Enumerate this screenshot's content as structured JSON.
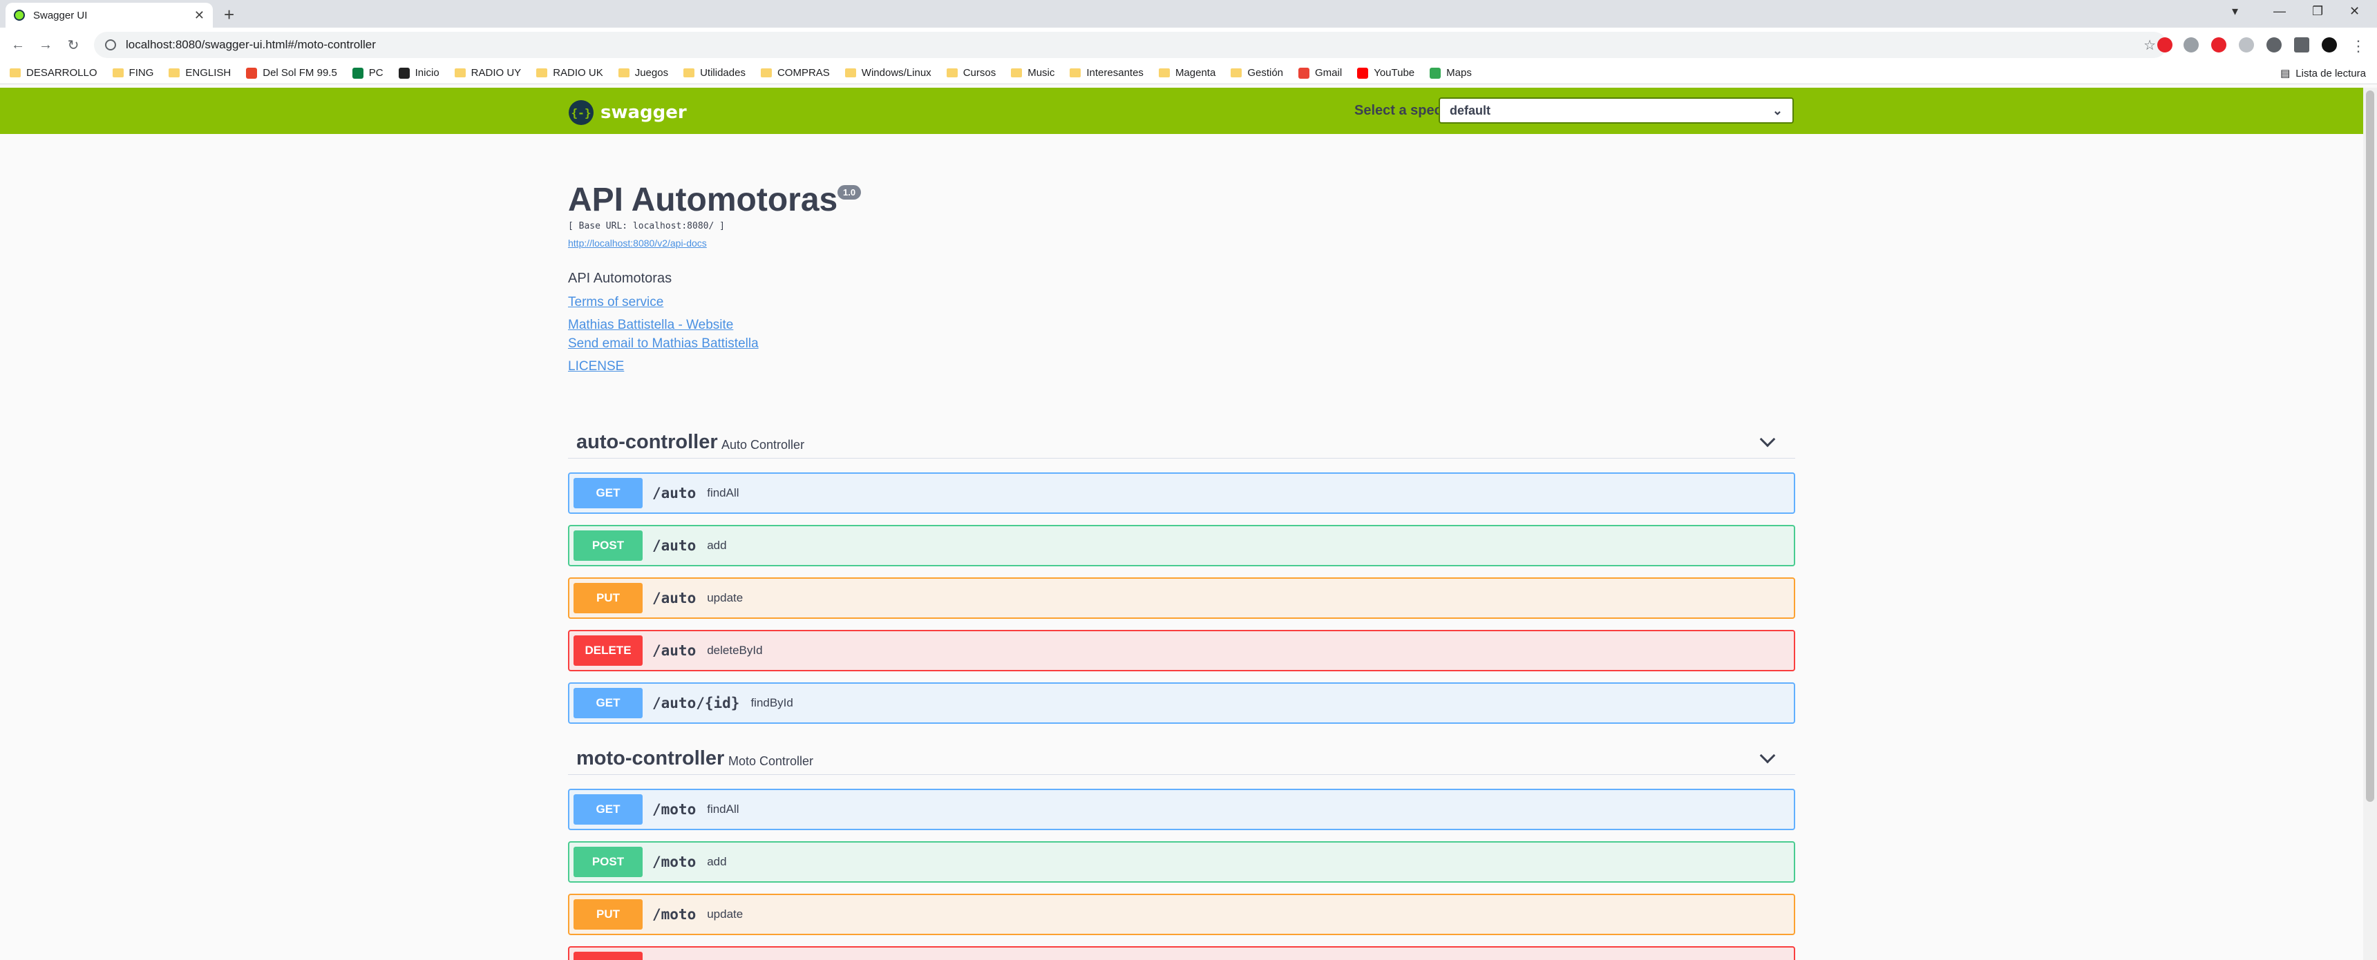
{
  "browser": {
    "tab_title": "Swagger UI",
    "url": "localhost:8080/swagger-ui.html#/moto-controller",
    "bookmarks": [
      {
        "label": "DESARROLLO",
        "icon": "folder-icon"
      },
      {
        "label": "FING",
        "icon": "folder-icon"
      },
      {
        "label": "ENGLISH",
        "icon": "folder-icon"
      },
      {
        "label": "Del Sol FM 99.5",
        "icon": "radio-icon"
      },
      {
        "label": "PC",
        "icon": "pc-icon"
      },
      {
        "label": "Inicio",
        "icon": "u-icon"
      },
      {
        "label": "RADIO UY",
        "icon": "folder-icon"
      },
      {
        "label": "RADIO UK",
        "icon": "folder-icon"
      },
      {
        "label": "Juegos",
        "icon": "folder-icon"
      },
      {
        "label": "Utilidades",
        "icon": "folder-icon"
      },
      {
        "label": "COMPRAS",
        "icon": "folder-icon"
      },
      {
        "label": "Windows/Linux",
        "icon": "folder-icon"
      },
      {
        "label": "Cursos",
        "icon": "folder-icon"
      },
      {
        "label": "Music",
        "icon": "folder-icon"
      },
      {
        "label": "Interesantes",
        "icon": "folder-icon"
      },
      {
        "label": "Magenta",
        "icon": "folder-icon"
      },
      {
        "label": "Gestión",
        "icon": "folder-icon"
      },
      {
        "label": "Gmail",
        "icon": "gmail-icon"
      },
      {
        "label": "YouTube",
        "icon": "youtube-icon"
      },
      {
        "label": "Maps",
        "icon": "maps-icon"
      }
    ],
    "reading_list": "Lista de lectura"
  },
  "swagger": {
    "logo_text": "swagger",
    "logo_glyph": "{-}",
    "spec_label": "Select a spec",
    "spec_value": "default",
    "colors": {
      "topbar": "#89bf04",
      "get": "#61affe",
      "post": "#49cc90",
      "put": "#fca130",
      "delete": "#f93e3e"
    }
  },
  "info": {
    "title": "API Automotoras",
    "version": "1.0",
    "base_url": "[ Base URL: localhost:8080/ ]",
    "api_docs": "http://localhost:8080/v2/api-docs",
    "description": "API Automotoras",
    "terms": "Terms of service",
    "website": "Mathias Battistella - Website",
    "email": "Send email to Mathias Battistella",
    "license": "LICENSE"
  },
  "tags": [
    {
      "name": "auto-controller",
      "description": "Auto Controller",
      "operations": [
        {
          "method": "GET",
          "path": "/auto",
          "summary": "findAll"
        },
        {
          "method": "POST",
          "path": "/auto",
          "summary": "add"
        },
        {
          "method": "PUT",
          "path": "/auto",
          "summary": "update"
        },
        {
          "method": "DELETE",
          "path": "/auto",
          "summary": "deleteById"
        },
        {
          "method": "GET",
          "path": "/auto/{id}",
          "summary": "findById"
        }
      ]
    },
    {
      "name": "moto-controller",
      "description": "Moto Controller",
      "operations": [
        {
          "method": "GET",
          "path": "/moto",
          "summary": "findAll"
        },
        {
          "method": "POST",
          "path": "/moto",
          "summary": "add"
        },
        {
          "method": "PUT",
          "path": "/moto",
          "summary": "update"
        }
      ]
    }
  ]
}
